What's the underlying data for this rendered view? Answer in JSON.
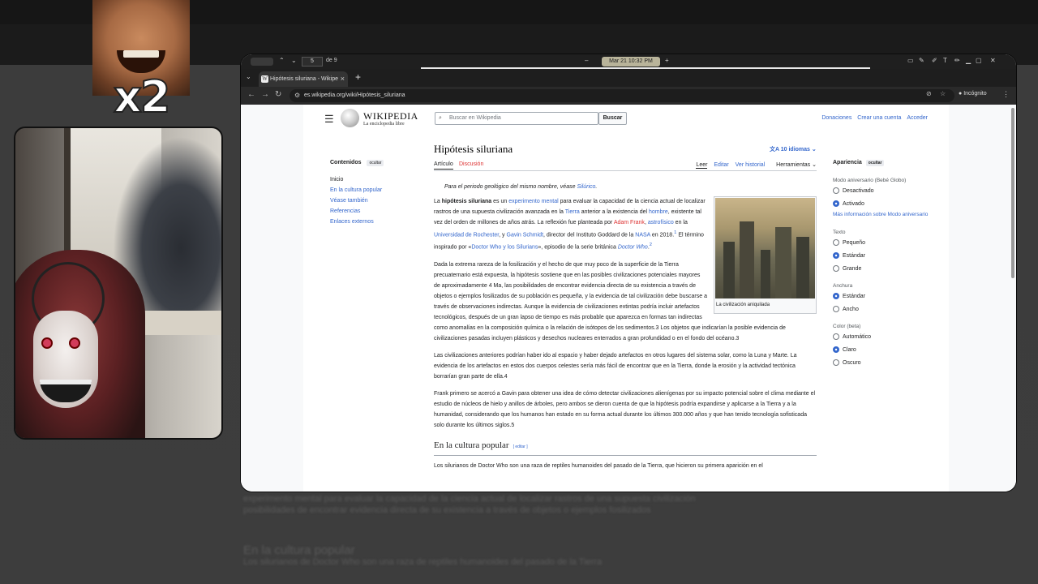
{
  "viewer": {
    "page_current": "5",
    "page_total": "de 9",
    "datetime": "Mar 21  10:32 PM"
  },
  "browser": {
    "tab_title": "Hipótesis siluriana - Wikipe",
    "url": "es.wikipedia.org/wiki/Hipótesis_siluriana",
    "incognito_label": "Incógnito"
  },
  "overlay": {
    "multiplier": "x2"
  },
  "header": {
    "logo_title": "WIKIPEDIA",
    "logo_subtitle": "La enciclopedia libre",
    "search_placeholder": "Buscar en Wikipedia",
    "search_button": "Buscar",
    "links": [
      "Donaciones",
      "Crear una cuenta",
      "Acceder"
    ]
  },
  "toc": {
    "title": "Contenidos",
    "hide": "ocultar",
    "items": [
      "Inicio",
      "En la cultura popular",
      "Véase también",
      "Referencias",
      "Enlaces externos"
    ]
  },
  "article": {
    "title": "Hipótesis siluriana",
    "languages": "10 idiomas",
    "tabs": {
      "article": "Artículo",
      "talk": "Discusión",
      "read": "Leer",
      "edit": "Editar",
      "history": "Ver historial",
      "tools": "Herramientas"
    },
    "hatnote_prefix": "Para el periodo geológico del mismo nombre, véase ",
    "hatnote_link": "Silúrico",
    "hatnote_suffix": ".",
    "image_caption": "La civilización aniquilada",
    "p1": {
      "a": "La ",
      "b": "hipótesis siluriana",
      "c": " es un ",
      "d": "experimento mental",
      "e": " para evaluar la capacidad de la ciencia actual de localizar rastros de una supuesta civilización avanzada en la ",
      "f": "Tierra",
      "g": " anterior a la existencia del ",
      "h": "hombre",
      "i": ", existente tal vez del orden de millones de años atrás. La reflexión fue planteada por ",
      "j": "Adam Frank",
      "k": ", ",
      "l": "astrofísico",
      "m": " en la ",
      "n": "Universidad de Rochester",
      "o": ", y ",
      "p": "Gavin Schmidt",
      "q": ", director del Instituto Goddard de la ",
      "r": "NASA",
      "s": " en 2018.",
      "t": "1",
      "u": "  El término inspirado por «",
      "v": "Doctor Who y los Silurians",
      "w": "», episodio de la serie británica ",
      "x": "Doctor Who",
      "y": ".",
      "z": "2"
    },
    "p2": "Dada la extrema rareza de la fosilización y el hecho de que muy poco de la superficie de la Tierra precuaternario está expuesta, la hipótesis sostiene que en las posibles civilizaciones potenciales mayores de aproximadamente 4 Ma, las posibilidades de encontrar evidencia directa de su existencia a través de objetos o ejemplos fosilizados de su población es pequeña, y la evidencia de tal civilización debe buscarse a través de observaciones indirectas. Aunque la evidencia de civilizaciones extintas podría incluir artefactos tecnológicos, después de un gran lapso de tiempo es más probable que aparezca en formas tan indirectas como anomalías en la composición química o la relación de isótopos de los sedimentos.3  Los objetos que indicarían la posible evidencia de civilizaciones pasadas incluyen plásticos y desechos nucleares enterrados a gran profundidad o en el fondo del océano.3",
    "p3": "Las civilizaciones anteriores podrían haber ido al espacio y haber dejado artefactos en otros lugares del sistema solar, como la Luna y Marte. La evidencia de los artefactos en estos dos cuerpos celestes sería más fácil de encontrar que en la Tierra, donde la erosión y la actividad tectónica borrarían gran parte de ella.4",
    "p4": "Frank primero se acercó a Gavin para obtener una idea de cómo detectar civilizaciones alienígenas por su impacto potencial sobre el clima mediante el estudio de núcleos de hielo y anillos de árboles, pero ambos se dieron cuenta de que la hipótesis podría expandirse y aplicarse a la Tierra y a la humanidad, considerando que los humanos han estado en su forma actual durante los últimos 300.000 años y que han tenido tecnología sofisticada solo durante los últimos siglos.5",
    "section_title": "En la cultura popular",
    "section_edit": "[ editar ]",
    "p5": "Los silurianos de Doctor Who son una raza de reptiles humanoides del pasado de la Tierra, que hicieron su primera aparición en el"
  },
  "appearance": {
    "title": "Apariencia",
    "hide": "ocultar",
    "anniv_label": "Modo aniversario (Bebé Globo)",
    "anniv_options": [
      "Desactivado",
      "Activado"
    ],
    "anniv_more": "Más información sobre Modo aniversario",
    "text_label": "Texto",
    "text_options": [
      "Pequeño",
      "Estándar",
      "Grande"
    ],
    "width_label": "Anchura",
    "width_options": [
      "Estándar",
      "Ancho"
    ],
    "color_label": "Color (beta)",
    "color_options": [
      "Automático",
      "Claro",
      "Oscuro"
    ]
  },
  "background": {
    "blur_line1": "experimento mental para evaluar la capacidad de la ciencia actual de localizar rastros de una supuesta civilización",
    "blur_line2": "posibilidades de encontrar evidencia directa de su existencia a través de objetos o ejemplos fosilizados",
    "blur_heading": "En la cultura popular",
    "blur_line3": "Los silurianos de Doctor Who son una raza de reptiles humanoides del pasado de la Tierra"
  }
}
